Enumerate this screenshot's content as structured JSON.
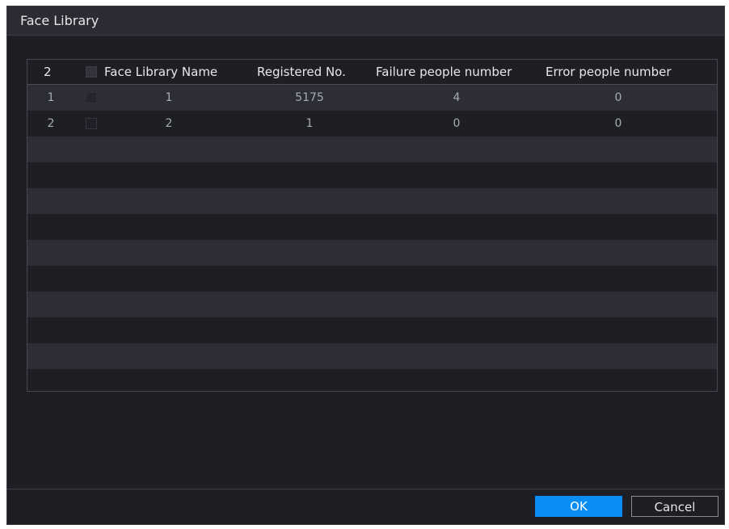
{
  "dialog": {
    "title": "Face Library"
  },
  "table": {
    "count_label": "2",
    "headers": {
      "name": "Face Library Name",
      "registered": "Registered No.",
      "failure": "Failure people number",
      "error": "Error people number"
    },
    "rows": [
      {
        "index": "1",
        "name": "1",
        "registered": "5175",
        "failure": "4",
        "error": "0"
      },
      {
        "index": "2",
        "name": "2",
        "registered": "1",
        "failure": "0",
        "error": "0"
      }
    ]
  },
  "buttons": {
    "ok": "OK",
    "cancel": "Cancel"
  },
  "colors": {
    "accent": "#0a8ef5",
    "background": "#1e1f24",
    "row_alt": "#2c2d35"
  }
}
